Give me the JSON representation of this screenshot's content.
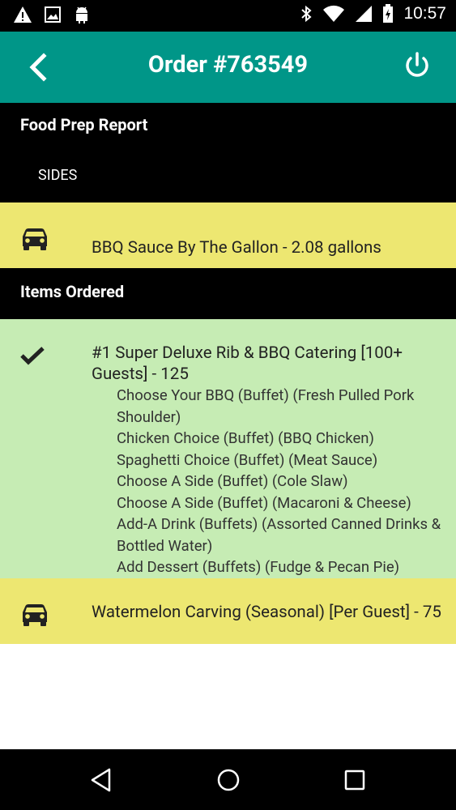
{
  "status_bar": {
    "time": "10:57",
    "left_icons": [
      "warning-icon",
      "image-icon",
      "android-icon"
    ],
    "right_icons": [
      "bluetooth-icon",
      "wifi-icon",
      "signal-icon",
      "battery-icon"
    ]
  },
  "app_bar": {
    "title": "Order #763549",
    "back_icon": "chevron-left-icon",
    "power_icon": "power-icon"
  },
  "food_prep": {
    "heading": "Food Prep Report",
    "category": "SIDES",
    "items": [
      {
        "icon": "car-icon",
        "text": "BBQ Sauce By The Gallon - 2.08 gallons"
      }
    ]
  },
  "items_ordered": {
    "heading": "Items Ordered",
    "items": [
      {
        "icon": "check-icon",
        "text": "#1 Super Deluxe Rib & BBQ Catering [100+ Guests] - 125",
        "options": [
          "Choose Your BBQ (Buffet) (Fresh Pulled Pork Shoulder)",
          "Chicken Choice (Buffet) (BBQ Chicken)",
          "Spaghetti Choice (Buffet) (Meat Sauce)",
          "Choose A Side (Buffet) (Cole Slaw)",
          "Choose A Side (Buffet) (Macaroni & Cheese)",
          "Add-A Drink (Buffets) (Assorted Canned Drinks & Bottled Water)",
          "Add Dessert (Buffets) (Fudge & Pecan Pie)"
        ]
      },
      {
        "icon": "car-icon",
        "text": "Watermelon Carving (Seasonal) [Per Guest] - 75"
      }
    ]
  },
  "colors": {
    "app_bar": "#009688",
    "pending_row": "#ede771",
    "done_row": "#c6ecb4",
    "section_header": "#000000"
  },
  "nav_bar": {
    "buttons": [
      "back-triangle-icon",
      "home-circle-icon",
      "recents-square-icon"
    ]
  }
}
